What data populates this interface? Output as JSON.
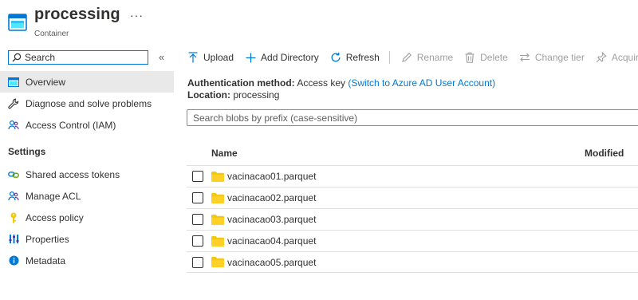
{
  "header": {
    "title": "processing",
    "subtitle": "Container",
    "more": "···"
  },
  "sidebar": {
    "search_placeholder": "Search",
    "collapse": "«",
    "items": [
      {
        "label": "Overview",
        "icon": "overview-icon"
      },
      {
        "label": "Diagnose and solve problems",
        "icon": "wrench-icon"
      },
      {
        "label": "Access Control (IAM)",
        "icon": "people-icon"
      }
    ],
    "settings_heading": "Settings",
    "settings_items": [
      {
        "label": "Shared access tokens",
        "icon": "link-icon"
      },
      {
        "label": "Manage ACL",
        "icon": "people-icon"
      },
      {
        "label": "Access policy",
        "icon": "key-icon"
      },
      {
        "label": "Properties",
        "icon": "properties-icon"
      },
      {
        "label": "Metadata",
        "icon": "info-icon"
      }
    ]
  },
  "toolbar": {
    "upload": "Upload",
    "add_directory": "Add Directory",
    "refresh": "Refresh",
    "rename": "Rename",
    "delete": "Delete",
    "change_tier": "Change tier",
    "acquire_lease": "Acquire lease"
  },
  "info": {
    "auth_label": "Authentication method:",
    "auth_value": "Access key",
    "auth_link": "(Switch to Azure AD User Account)",
    "location_label": "Location:",
    "location_value": "processing"
  },
  "blob_search": {
    "placeholder": "Search blobs by prefix (case-sensitive)"
  },
  "table": {
    "columns": {
      "name": "Name",
      "modified": "Modified"
    },
    "rows": [
      {
        "name": "vacinacao01.parquet"
      },
      {
        "name": "vacinacao02.parquet"
      },
      {
        "name": "vacinacao03.parquet"
      },
      {
        "name": "vacinacao04.parquet"
      },
      {
        "name": "vacinacao05.parquet"
      }
    ]
  },
  "colors": {
    "accent": "#0078d4",
    "folder": "#f2c811",
    "active_bg": "#e9e9e9"
  }
}
